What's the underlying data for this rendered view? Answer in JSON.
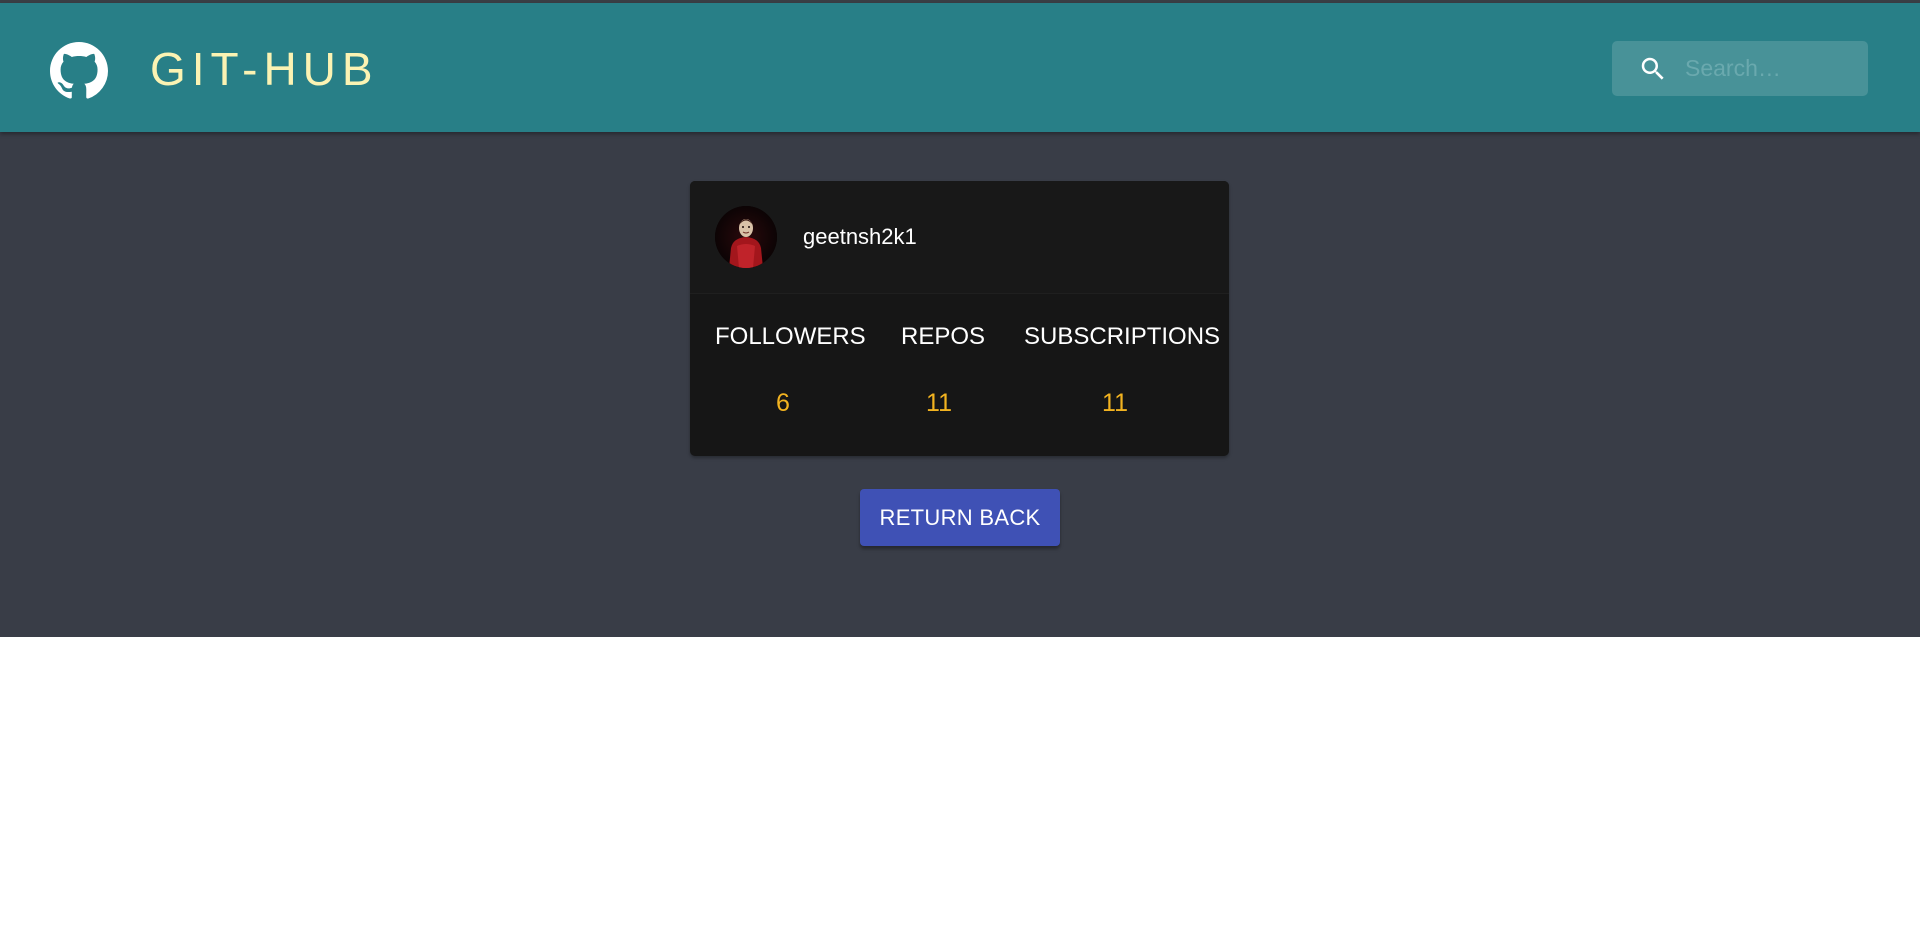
{
  "header": {
    "brand": "GIT-HUB",
    "logo_icon": "github-octocat-icon",
    "search": {
      "placeholder": "Search…",
      "value": "",
      "icon": "search-icon"
    }
  },
  "profile": {
    "username": "geetnsh2k1",
    "avatar_icon": "avatar-red-jumpsuit-mask",
    "stats": [
      {
        "label": "FOLLOWERS",
        "value": "6"
      },
      {
        "label": "REPOS",
        "value": "11"
      },
      {
        "label": "SUBSCRIPTIONS",
        "value": "11"
      }
    ]
  },
  "actions": {
    "return_label": "RETURN BACK"
  },
  "colors": {
    "appbar": "#287f87",
    "brand_text": "#fbf3b3",
    "page_bg": "#393d47",
    "card_bg": "#161616",
    "stat_value": "#f2b320",
    "button": "#3f51b5"
  }
}
